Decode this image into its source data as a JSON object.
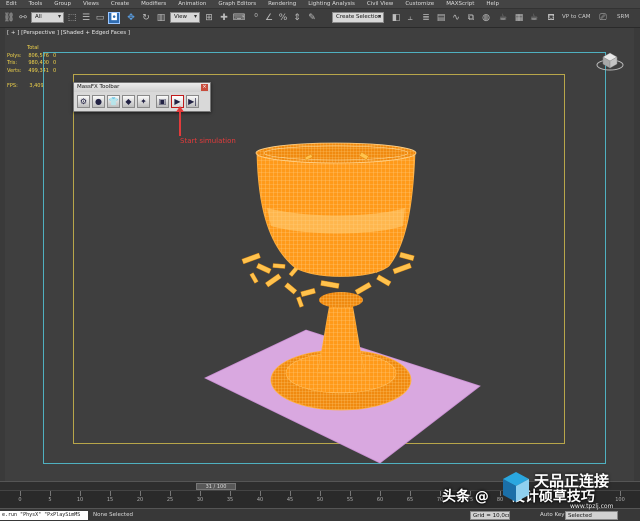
{
  "menu": [
    "Edit",
    "Tools",
    "Group",
    "Views",
    "Create",
    "Modifiers",
    "Animation",
    "Graph Editors",
    "Rendering",
    "Lighting Analysis",
    "Civil View",
    "Customize",
    "MAXScript",
    "Help"
  ],
  "toolbar": {
    "filter": "All",
    "coord": "View",
    "selection_set": "Create Selection S▾",
    "vp_to_cam": "VP to CAM",
    "srm": "SRM"
  },
  "viewport": {
    "label": "[ + ] [Perspective ] [Shaded + Edged Faces ]",
    "stats_header": "Total",
    "stats": [
      {
        "k": "Polys:",
        "v": "806,576",
        "z": "0"
      },
      {
        "k": "Tris:",
        "v": "980,400",
        "z": "0"
      },
      {
        "k": "Verts:",
        "v": "499,341",
        "z": "0"
      }
    ],
    "fps_label": "FPS:",
    "fps_value": "3,409"
  },
  "maxfx": {
    "title": "MassFX Toolbar",
    "close": "×",
    "buttons": [
      "⚙",
      "●",
      "👕",
      "◆",
      "✦",
      "▣",
      "▶",
      "▶|"
    ]
  },
  "annotation": "Start simulation",
  "timeline": {
    "frame": "31 / 100",
    "ticks": [
      "0",
      "5",
      "10",
      "15",
      "20",
      "25",
      "30",
      "35",
      "40",
      "45",
      "50",
      "55",
      "60",
      "65",
      "70",
      "75",
      "80",
      "85",
      "90",
      "95",
      "100"
    ]
  },
  "status": {
    "script": "e.run \"PhysX\" \"PxPlaySimMS",
    "none_selected": "None Selected",
    "grid": "Grid = 10,0cm",
    "auto_key": "Auto Key",
    "selected": "Selected"
  },
  "watermark": {
    "toutiao": "头条 @",
    "name": "设计硕草技巧",
    "brand": "天品正连接",
    "url": "www.tpzlj.com"
  },
  "colors": {
    "object": "#ff9a1a",
    "plane": "#d9a8e0",
    "annotation": "#e23b3b",
    "frame_outer": "#4fb0c0",
    "frame_inner": "#b8a64a"
  }
}
